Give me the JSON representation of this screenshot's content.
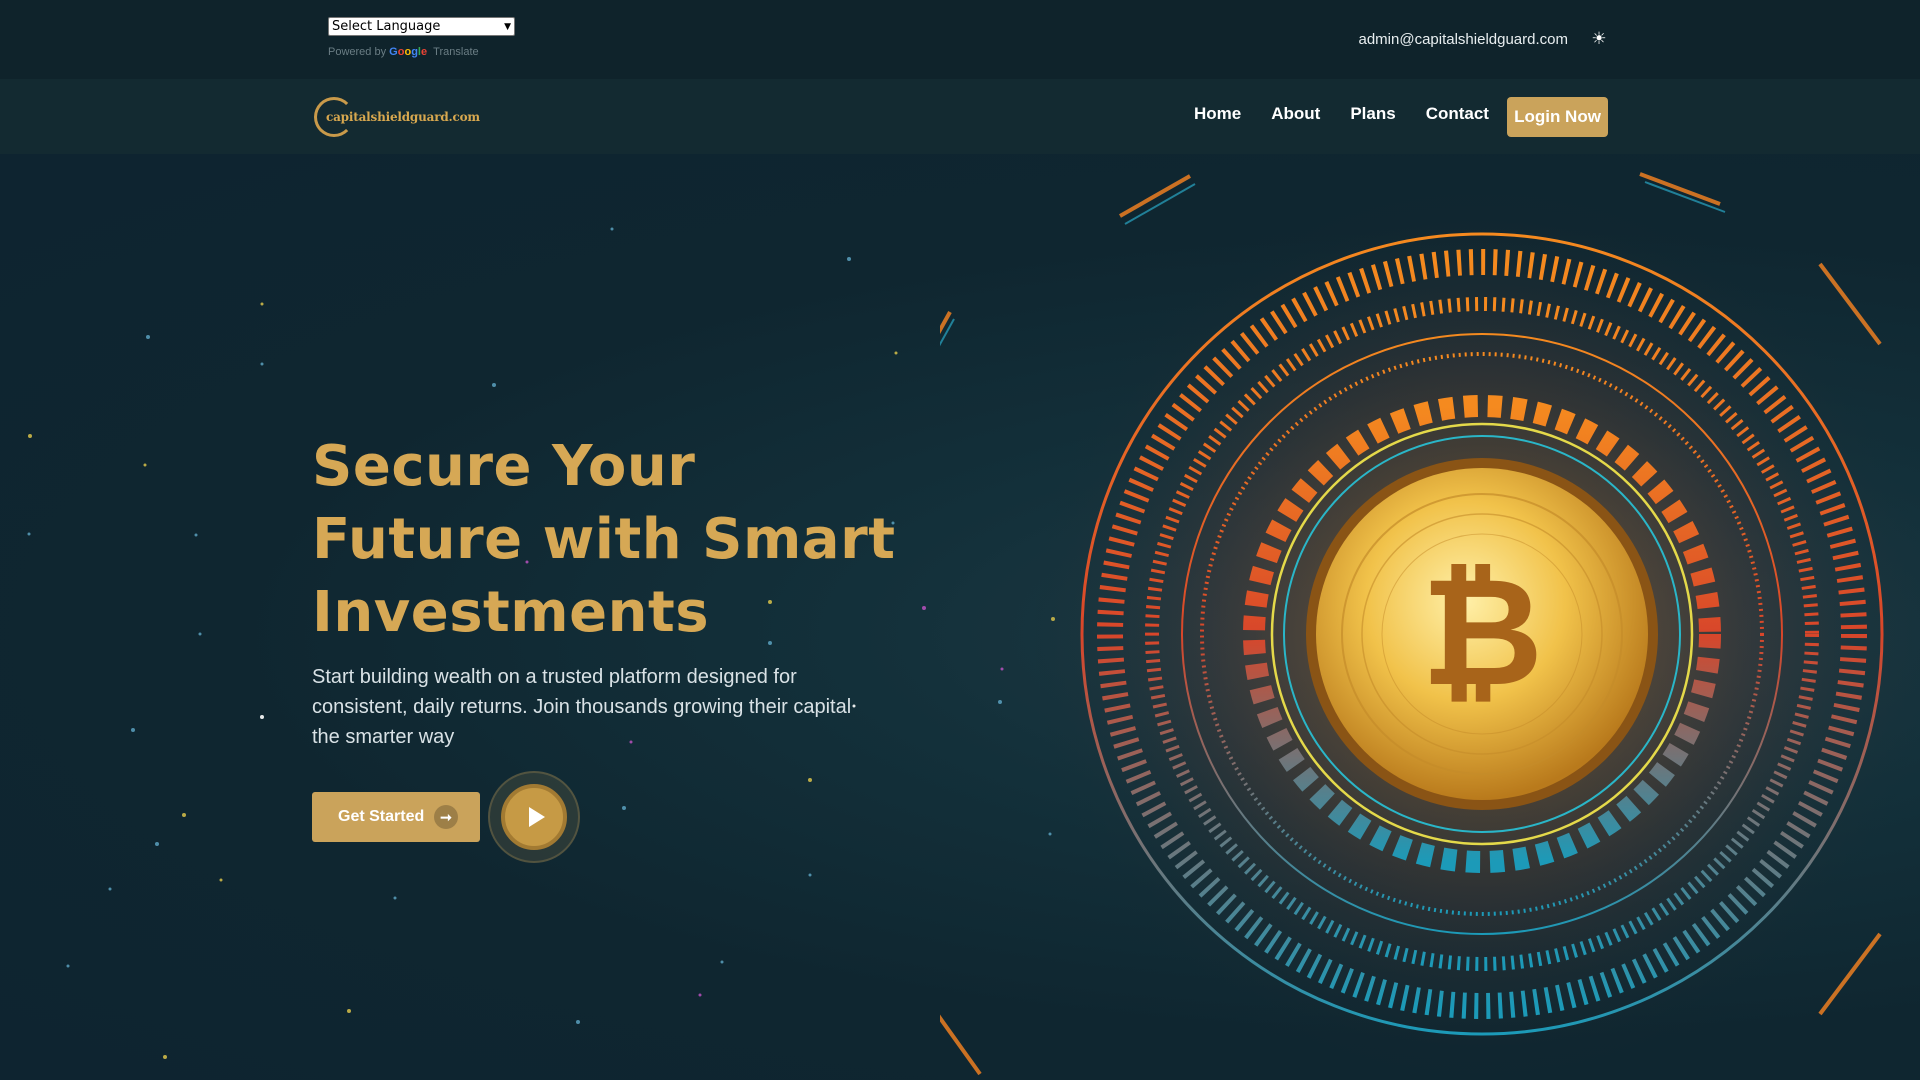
{
  "topbar": {
    "language_select": "Select Language",
    "powered_by": "Powered by",
    "google": "Google",
    "translate": "Translate",
    "email": "admin@capitalshieldguard.com",
    "theme_icon": "sun-icon"
  },
  "navbar": {
    "logo_text": "capitalshieldguard.com",
    "items": [
      {
        "label": "Home"
      },
      {
        "label": "About"
      },
      {
        "label": "Plans"
      },
      {
        "label": "Contact"
      }
    ],
    "login_label": "Login Now"
  },
  "hero": {
    "title": "Secure Your Future with Smart Investments",
    "subtitle": "Start building wealth on a trusted platform designed for consistent, daily returns. Join thousands growing their capital the smarter way",
    "cta_label": "Get Started",
    "play_icon": "play-icon",
    "art_icon": "bitcoin-icon"
  },
  "colors": {
    "accent": "#caa35b",
    "title_gold": "#d6a855",
    "background": "#0f2630"
  }
}
